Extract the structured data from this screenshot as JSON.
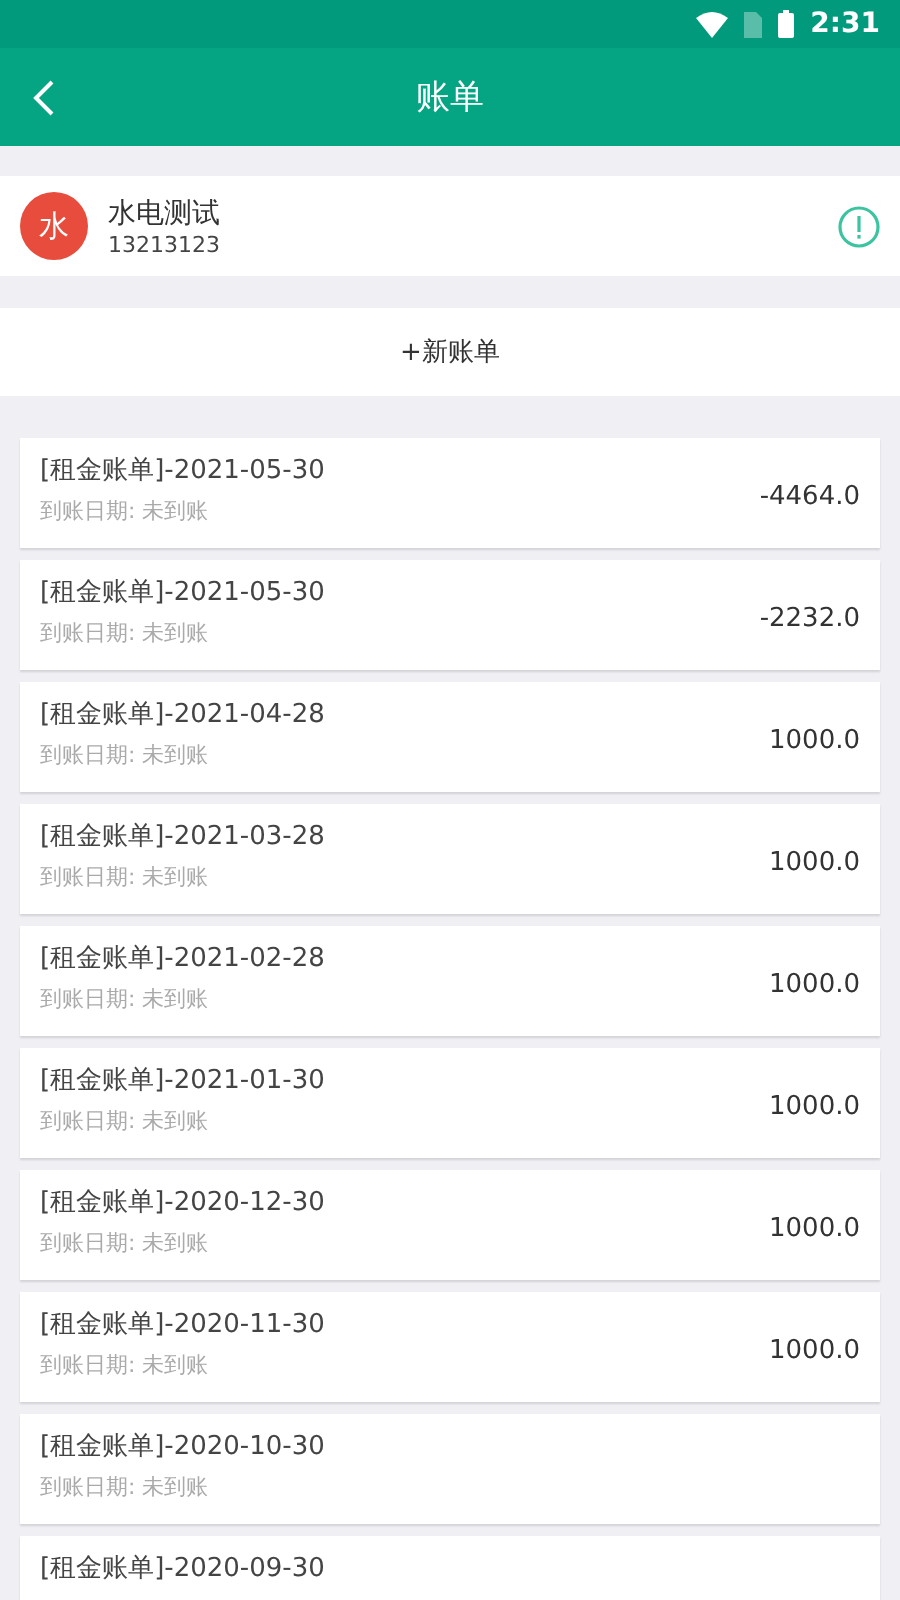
{
  "status_bar": {
    "time": "2:31"
  },
  "header": {
    "title": "账单"
  },
  "contact": {
    "avatar": "水",
    "name": "水电测试",
    "phone": "13213123"
  },
  "new_bill": {
    "label": "+新账单"
  },
  "bills": [
    {
      "title": "[租金账单]-2021-05-30",
      "subtitle": "到账日期: 未到账",
      "amount": "-4464.0"
    },
    {
      "title": "[租金账单]-2021-05-30",
      "subtitle": "到账日期: 未到账",
      "amount": "-2232.0"
    },
    {
      "title": "[租金账单]-2021-04-28",
      "subtitle": "到账日期: 未到账",
      "amount": "1000.0"
    },
    {
      "title": "[租金账单]-2021-03-28",
      "subtitle": "到账日期: 未到账",
      "amount": "1000.0"
    },
    {
      "title": "[租金账单]-2021-02-28",
      "subtitle": "到账日期: 未到账",
      "amount": "1000.0"
    },
    {
      "title": "[租金账单]-2021-01-30",
      "subtitle": "到账日期: 未到账",
      "amount": "1000.0"
    },
    {
      "title": "[租金账单]-2020-12-30",
      "subtitle": "到账日期: 未到账",
      "amount": "1000.0"
    },
    {
      "title": "[租金账单]-2020-11-30",
      "subtitle": "到账日期: 未到账",
      "amount": "1000.0"
    },
    {
      "title": "[租金账单]-2020-10-30",
      "subtitle": "到账日期: 未到账"
    },
    {
      "title": "[租金账单]-2020-09-30"
    }
  ]
}
